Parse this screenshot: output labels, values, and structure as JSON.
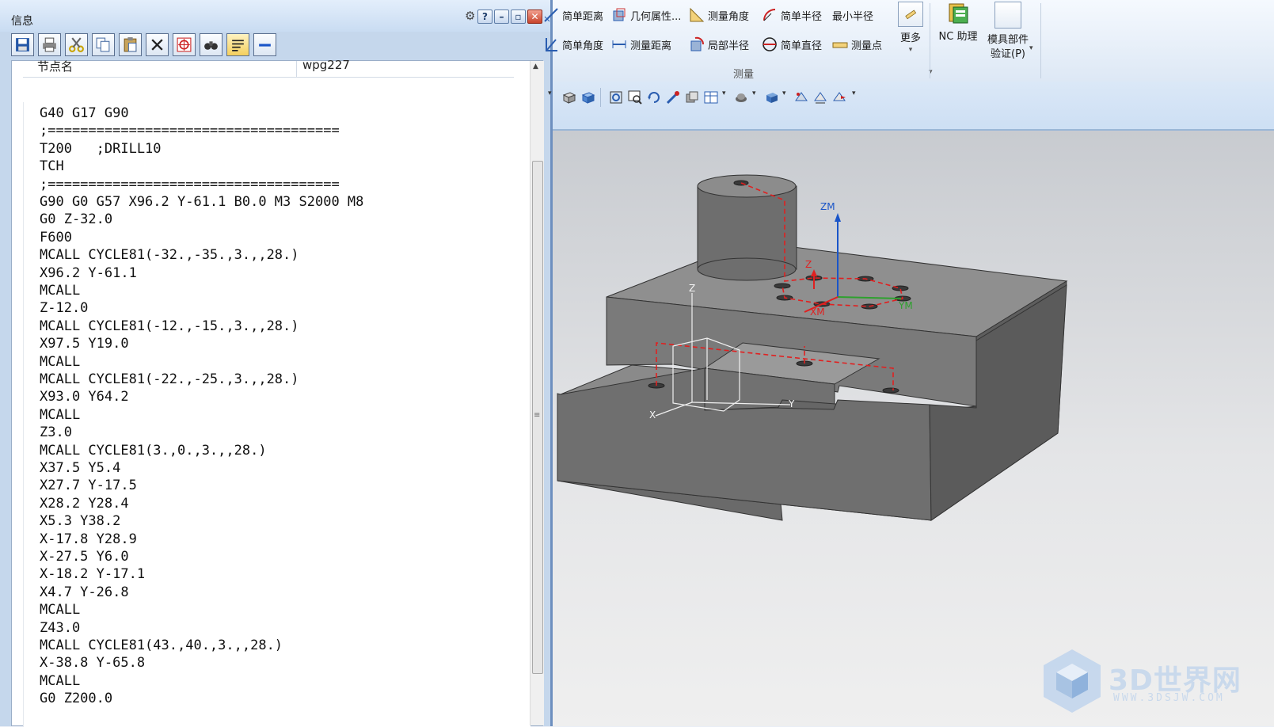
{
  "info_window": {
    "title": "信息",
    "header": {
      "col1": "节点名",
      "col2": "wpg227"
    },
    "code_lines": [
      "G40 G17 G90",
      ";====================================",
      "T200   ;DRILL10",
      "TCH",
      ";====================================",
      "G90 G0 G57 X96.2 Y-61.1 B0.0 M3 S2000 M8",
      "G0 Z-32.0",
      "F600",
      "MCALL CYCLE81(-32.,-35.,3.,,28.)",
      "X96.2 Y-61.1",
      "MCALL",
      "Z-12.0",
      "MCALL CYCLE81(-12.,-15.,3.,,28.)",
      "X97.5 Y19.0",
      "MCALL",
      "MCALL CYCLE81(-22.,-25.,3.,,28.)",
      "X93.0 Y64.2",
      "MCALL",
      "Z3.0",
      "MCALL CYCLE81(3.,0.,3.,,28.)",
      "X37.5 Y5.4",
      "X27.7 Y-17.5",
      "X28.2 Y28.4",
      "X5.3 Y38.2",
      "X-17.8 Y28.9",
      "X-27.5 Y6.0",
      "X-18.2 Y-17.1",
      "X4.7 Y-26.8",
      "MCALL",
      "Z43.0",
      "MCALL CYCLE81(43.,40.,3.,,28.)",
      "X-38.8 Y-65.8",
      "MCALL",
      "G0 Z200.0"
    ],
    "toolbar_icons": [
      "save-icon",
      "print-icon",
      "cut-icon",
      "copy-icon",
      "paste-icon",
      "delete-icon",
      "target-icon",
      "binoculars-icon",
      "wrap-icon",
      "minus-icon"
    ]
  },
  "ribbon": {
    "row1": [
      "简单距离",
      "几何属性...",
      "测量角度",
      "简单半径",
      "最小半径"
    ],
    "row2": [
      "简单角度",
      "测量距离",
      "局部半径",
      "简单直径",
      "测量点"
    ],
    "group_label": "测量",
    "more_label": "更多",
    "nc_label": "NC 助理",
    "mold_label_1": "模具部件",
    "mold_label_2": "验证(P)"
  },
  "viewport": {
    "axis_labels": {
      "zm": "ZM",
      "ym": "YM",
      "xm": "XM",
      "z": "Z",
      "y": "Y",
      "x": "X",
      "z2": "Z"
    }
  },
  "watermark": {
    "text": "3D世界网",
    "sub": "WWW.3DSJW.COM"
  },
  "colors": {
    "accent": "#1a55c8",
    "toolpath": "#e02020",
    "axis_green": "#2ea12e"
  }
}
